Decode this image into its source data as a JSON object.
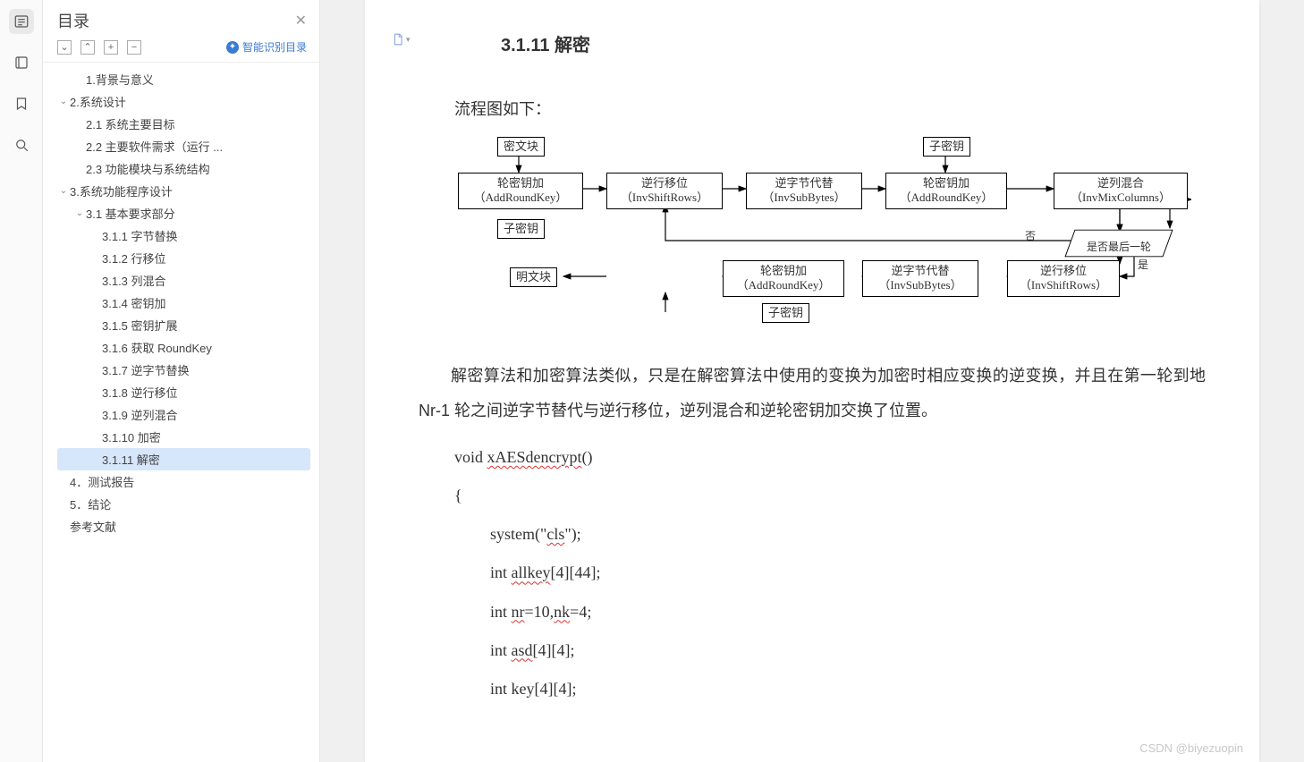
{
  "sidebar": {
    "title": "目录",
    "smart_label": "智能识别目录",
    "tool_expand": "⌄",
    "tool_collapse": "⌃",
    "tool_plus": "+",
    "tool_minus": "−",
    "items": [
      {
        "level": 2,
        "label": "1.背景与意义",
        "expand": ""
      },
      {
        "level": 1,
        "label": "2.系统设计",
        "expand": "⌄"
      },
      {
        "level": 2,
        "label": "2.1 系统主要目标",
        "expand": ""
      },
      {
        "level": 2,
        "label": "2.2 主要软件需求（运行 ...",
        "expand": ""
      },
      {
        "level": 2,
        "label": "2.3 功能模块与系统结构",
        "expand": ""
      },
      {
        "level": 1,
        "label": "3.系统功能程序设计",
        "expand": "⌄"
      },
      {
        "level": 2,
        "label": "3.1 基本要求部分",
        "expand": "⌄"
      },
      {
        "level": 3,
        "label": "3.1.1 字节替换",
        "expand": ""
      },
      {
        "level": 3,
        "label": "3.1.2 行移位",
        "expand": ""
      },
      {
        "level": 3,
        "label": "3.1.3 列混合",
        "expand": ""
      },
      {
        "level": 3,
        "label": "3.1.4 密钥加",
        "expand": ""
      },
      {
        "level": 3,
        "label": "3.1.5 密钥扩展",
        "expand": ""
      },
      {
        "level": 3,
        "label": "3.1.6 获取 RoundKey",
        "expand": ""
      },
      {
        "level": 3,
        "label": "3.1.7 逆字节替换",
        "expand": ""
      },
      {
        "level": 3,
        "label": "3.1.8 逆行移位",
        "expand": ""
      },
      {
        "level": 3,
        "label": "3.1.9 逆列混合",
        "expand": ""
      },
      {
        "level": 3,
        "label": "3.1.10 加密",
        "expand": ""
      },
      {
        "level": 3,
        "label": "3.1.11 解密",
        "expand": "",
        "selected": true
      },
      {
        "level": 1,
        "label": "4．测试报告",
        "expand": ""
      },
      {
        "level": 1,
        "label": "5．结论",
        "expand": ""
      },
      {
        "level": 1,
        "label": "参考文献",
        "expand": ""
      }
    ]
  },
  "document": {
    "heading": "3.1.11 解密",
    "intro": "流程图如下：",
    "flowchart": {
      "cipher_block": "密文块",
      "subkey1": "子密钥",
      "addroundkey1_t": "轮密钥加",
      "addroundkey1_b": "（AddRoundKey）",
      "invshiftrows1_t": "逆行移位",
      "invshiftrows1_b": "（InvShiftRows）",
      "invsubbytes1_t": "逆字节代替",
      "invsubbytes1_b": "（InvSubBytes）",
      "addroundkey2_t": "轮密钥加",
      "addroundkey2_b": "（AddRoundKey）",
      "subkey2": "子密钥",
      "invmixcols_t": "逆列混合",
      "invmixcols_b": "（InvMixColumns）",
      "decision": "是否最后一轮",
      "no_label": "否",
      "yes_label": "是",
      "invshiftrows2_t": "逆行移位",
      "invshiftrows2_b": "（InvShiftRows）",
      "invsubbytes2_t": "逆字节代替",
      "invsubbytes2_b": "（InvSubBytes）",
      "addroundkey3_t": "轮密钥加",
      "addroundkey3_b": "（AddRoundKey）",
      "subkey3": "子密钥",
      "plain_block": "明文块"
    },
    "paragraph": "解密算法和加密算法类似，只是在解密算法中使用的变换为加密时相应变换的逆变换，并且在第一轮到地 Nr-1 轮之间逆字节替代与逆行移位，逆列混合和逆轮密钥加交换了位置。",
    "code": [
      {
        "indent": 1,
        "text": "void ",
        "u": "xAESdencrypt",
        "tail": "()"
      },
      {
        "indent": 1,
        "text": "{",
        "u": "",
        "tail": ""
      },
      {
        "indent": 2,
        "text": "system(\"",
        "u": "cls",
        "tail": "\");"
      },
      {
        "indent": 2,
        "text": "int ",
        "u": "allkey",
        "tail": "[4][44];"
      },
      {
        "indent": 2,
        "text": "int ",
        "u": "nr",
        "tail": "=10,",
        "u2": "nk",
        "tail2": "=4;"
      },
      {
        "indent": 2,
        "text": "int ",
        "u": "asd",
        "tail": "[4][4];"
      },
      {
        "indent": 2,
        "text": "int key[4][4];",
        "u": "",
        "tail": ""
      }
    ]
  },
  "watermark": "CSDN @biyezuopin"
}
